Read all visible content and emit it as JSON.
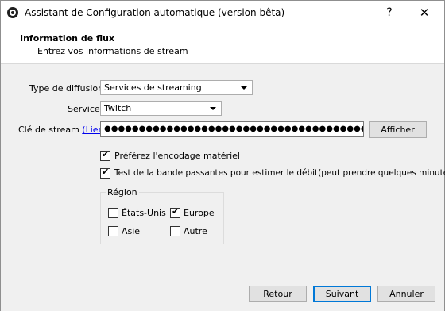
{
  "window": {
    "title": "Assistant de Configuration automatique (version bêta)",
    "help_label": "?",
    "close_label": "✕"
  },
  "header": {
    "title": "Information de flux",
    "subtitle": "Entrez vos informations de stream"
  },
  "form": {
    "broadcast_type_label": "Type de diffusion",
    "broadcast_type_value": "Services de streaming",
    "service_label": "Service",
    "service_value": "Twitch",
    "stream_key_label": "Clé de stream",
    "stream_key_link": "(Lien)",
    "stream_key_value": "●●●●●●●●●●●●●●●●●●●●●●●●●●●●●●●●●●●●●●●●●●●●",
    "show_button": "Afficher",
    "hw_encoding_label": "Préférez l'encodage matériel",
    "hw_encoding_checked": true,
    "bandwidth_test_label": "Test de la bande passantes pour estimer le débit(peut prendre quelques minutes)",
    "bandwidth_test_checked": true
  },
  "region": {
    "title": "Région",
    "options": [
      {
        "label": "États-Unis",
        "checked": false
      },
      {
        "label": "Europe",
        "checked": true
      },
      {
        "label": "Asie",
        "checked": false
      },
      {
        "label": "Autre",
        "checked": false
      }
    ]
  },
  "footer": {
    "back_button": "Retour",
    "next_button": "Suivant",
    "cancel_button": "Annuler"
  },
  "icons": {
    "app": "obs-logo-icon",
    "check": "checkmark-icon",
    "dropdown": "chevron-down-icon"
  }
}
